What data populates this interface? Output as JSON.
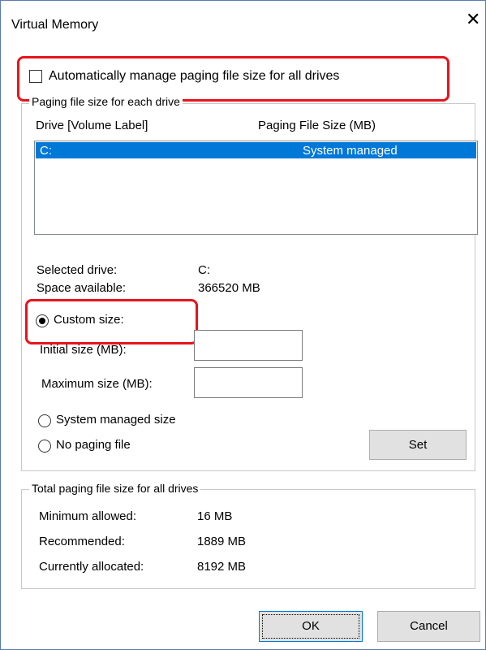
{
  "window": {
    "title": "Virtual Memory"
  },
  "auto_manage": {
    "label": "Automatically manage paging file size for all drives",
    "checked": false
  },
  "paging_group": {
    "legend": "Paging file size for each drive",
    "col_drive": "Drive  [Volume Label]",
    "col_size": "Paging File Size (MB)",
    "rows": [
      {
        "drive": "C:",
        "size": "System managed",
        "selected": true
      }
    ]
  },
  "selected_drive": {
    "label": "Selected drive:",
    "value": "C:"
  },
  "space_available": {
    "label": "Space available:",
    "value": "366520 MB"
  },
  "custom_size": {
    "label": "Custom size:",
    "checked": true
  },
  "initial_size": {
    "label": "Initial size (MB):",
    "value": ""
  },
  "maximum_size": {
    "label": "Maximum size (MB):",
    "value": ""
  },
  "system_managed": {
    "label": "System managed size",
    "checked": false
  },
  "no_paging": {
    "label": "No paging file",
    "checked": false
  },
  "set_button": {
    "label": "Set"
  },
  "totals_group": {
    "legend": "Total paging file size for all drives",
    "minimum": {
      "label": "Minimum allowed:",
      "value": "16 MB"
    },
    "recommended": {
      "label": "Recommended:",
      "value": "1889 MB"
    },
    "allocated": {
      "label": "Currently allocated:",
      "value": "8192 MB"
    }
  },
  "ok_button": {
    "label": "OK"
  },
  "cancel_button": {
    "label": "Cancel"
  },
  "colors": {
    "highlight": "#e8141c",
    "selection": "#0078d7",
    "button": "#e1e1e1"
  }
}
